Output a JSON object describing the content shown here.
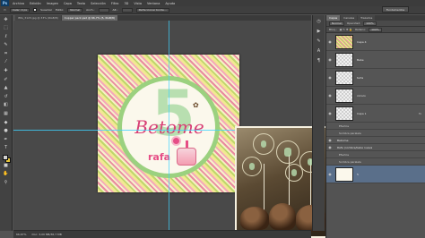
{
  "app": {
    "logo": "Ps",
    "menu": [
      "Archivo",
      "Edición",
      "Imagen",
      "Capa",
      "Texto",
      "Selección",
      "Filtro",
      "3D",
      "Vista",
      "Ventana",
      "Ayuda"
    ],
    "workspace": "Fundamentos"
  },
  "options": {
    "feather_label": "Calar: 0 px",
    "antialias_label": "Suavizar",
    "style_label": "Estilo:",
    "style_value": "Normal",
    "width_label": "Anch.:",
    "height_label": "Alt.:",
    "refine_button": "Perfeccionar borde..."
  },
  "document_tabs": [
    {
      "label": "IMG_3123.jpg @ 33% (RGB/8)",
      "active": false
    },
    {
      "label": "Cupper pack.psd @ 66,7% (5, RGB/8)",
      "active": true
    }
  ],
  "artwork": {
    "number": "5",
    "script_text": "Betome",
    "name_text": "rafa"
  },
  "status": {
    "zoom": "66,67%",
    "doc_info": "Doc: 3,00 MB/36,7 MB"
  },
  "tools": [
    "move-icon",
    "marquee-icon",
    "lasso-icon",
    "quick-select-icon",
    "crop-icon",
    "eyedropper-icon",
    "healing-icon",
    "brush-icon",
    "stamp-icon",
    "history-brush-icon",
    "eraser-icon",
    "gradient-icon",
    "blur-icon",
    "dodge-icon",
    "pen-icon",
    "type-icon",
    "path-select-icon",
    "shape-icon",
    "hand-icon",
    "zoom-icon"
  ],
  "layers_panel": {
    "tabs": [
      "Capas",
      "Canales",
      "Trazados"
    ],
    "blend_mode": "Normal",
    "opacity_label": "Opacidad:",
    "opacity_value": "100%",
    "lock_label": "Bloq.:",
    "fill_label": "Relleno:",
    "fill_value": "100%",
    "layers": [
      {
        "name": "Capa 4",
        "thumb": "art",
        "selected": false
      },
      {
        "name": "Bebe",
        "thumb": "transparent",
        "selected": false
      },
      {
        "name": "tarta",
        "thumb": "transparent",
        "selected": false
      },
      {
        "name": "circulo",
        "thumb": "transparent",
        "selected": false
      },
      {
        "name": "Capa 1",
        "thumb": "transparent",
        "selected": false
      }
    ],
    "effects_1": [
      "Efectos",
      "Sombra paralela"
    ],
    "text_layers": [
      "Bebome",
      "Rafa (nombre/bebe nueva"
    ],
    "effects_2": [
      "Efectos",
      "Sombra paralela"
    ],
    "bottom_layer": {
      "name": "5",
      "thumb": "cake",
      "selected": true
    }
  },
  "colors": {
    "foreground": "#d1d1d1",
    "background": "#e5c43a",
    "guide": "#3fd3ff"
  }
}
